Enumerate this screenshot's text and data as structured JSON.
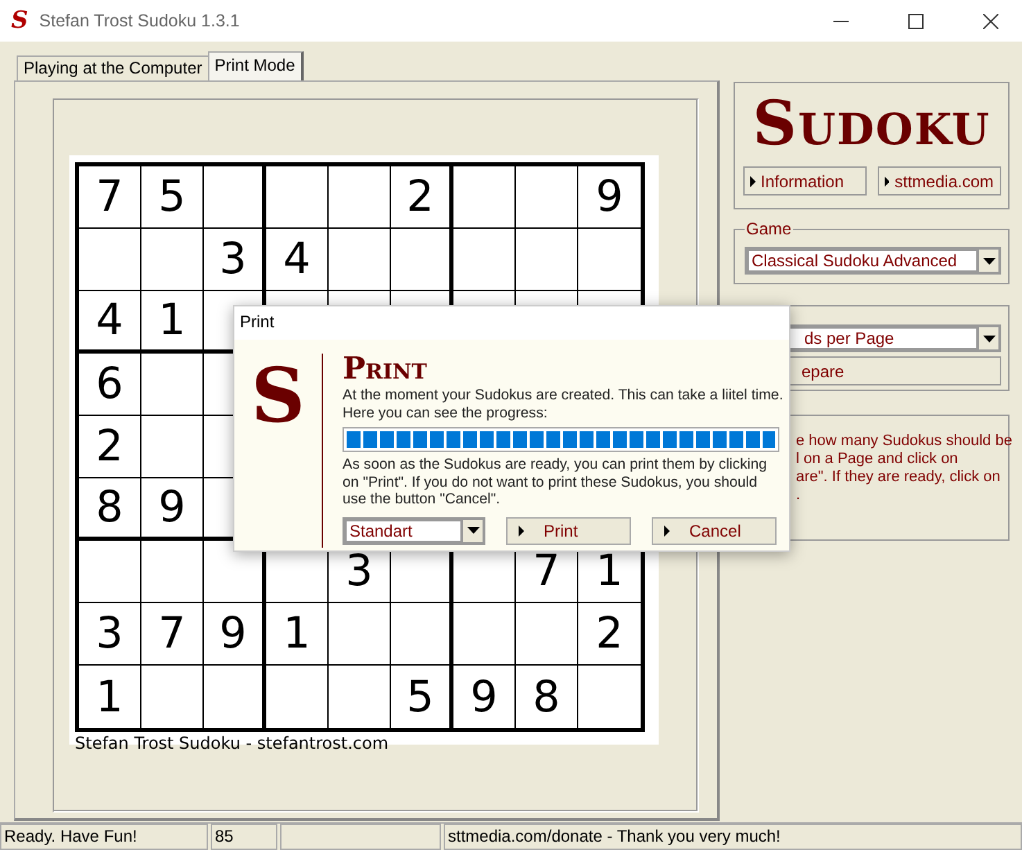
{
  "window": {
    "icon_letter": "S",
    "title": "Stefan Trost Sudoku 1.3.1"
  },
  "tabs": [
    {
      "label": "Playing at the Computer",
      "selected": false
    },
    {
      "label": "Print Mode",
      "selected": true
    }
  ],
  "puzzle": {
    "rows": [
      [
        "7",
        "5",
        null,
        null,
        null,
        "2",
        null,
        null,
        "9"
      ],
      [
        null,
        null,
        "3",
        "4",
        null,
        null,
        null,
        null,
        null
      ],
      [
        "4",
        "1",
        null,
        null,
        null,
        null,
        null,
        null,
        null
      ],
      [
        "6",
        null,
        null,
        null,
        null,
        null,
        null,
        null,
        null
      ],
      [
        "2",
        null,
        null,
        null,
        null,
        null,
        null,
        null,
        null
      ],
      [
        "8",
        "9",
        null,
        null,
        null,
        null,
        null,
        null,
        null
      ],
      [
        null,
        null,
        null,
        null,
        "3",
        null,
        null,
        "7",
        "1"
      ],
      [
        "3",
        "7",
        "9",
        "1",
        null,
        null,
        null,
        null,
        "2"
      ],
      [
        "1",
        null,
        null,
        null,
        null,
        "5",
        "9",
        "8",
        null
      ]
    ],
    "footer": "Stefan Trost Sudoku - stefantrost.com"
  },
  "side_panel": {
    "logo": "Sudoku",
    "buttons": [
      "Information",
      "sttmedia.com"
    ],
    "game": {
      "label": "Game",
      "value": "Classical Sudoku Advanced"
    },
    "print": {
      "value": "ds per Page",
      "button": "epare"
    },
    "hint_lines": [
      "e how many Sudokus should be",
      "l on a Page and click on",
      "are\". If they are ready, click on",
      "."
    ]
  },
  "dialog": {
    "title": "Print",
    "logo_letter": "S",
    "heading": "Print",
    "text_1": [
      "At the moment your Sudokus are created. This can take a liitel time.",
      "Here you can see the progress:"
    ],
    "progress": {
      "level": 1
    },
    "text_2": [
      "As soon as the Sudokus are ready, you can print them by clicking",
      "on \"Print\". If you do not want to print these Sudokus, you should",
      "use the button \"Cancel\"."
    ],
    "select": "Standart",
    "buttons": [
      "Print",
      "Cancel"
    ]
  },
  "status_bar": {
    "message": "Ready. Have Fun!",
    "count": "85",
    "link": "sttmedia.com/donate - Thank you very much!"
  }
}
